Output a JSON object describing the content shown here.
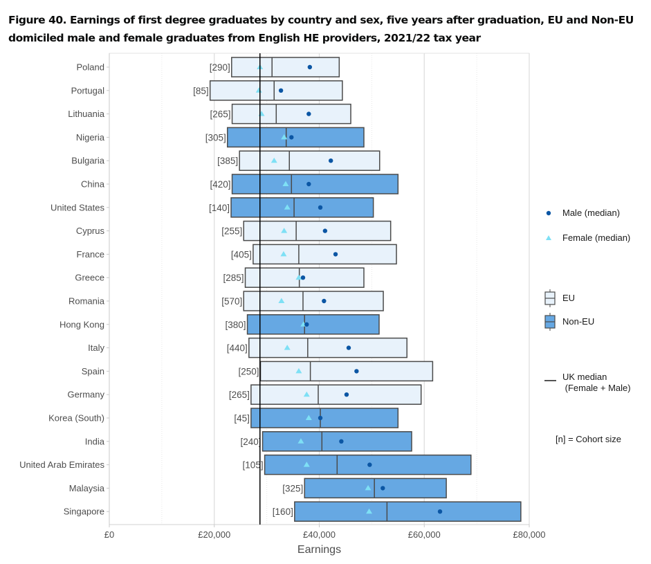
{
  "figure": {
    "title": "Figure 40. Earnings of first degree graduates by country and sex, five years after graduation, EU and Non-EU domiciled male and female graduates from English HE providers, 2021/22 tax year"
  },
  "legend": {
    "male": "Male (median)",
    "female": "Female (median)",
    "eu": "EU",
    "non_eu": "Non-EU",
    "uk_median_line1": "UK median",
    "uk_median_line2": " (Female + Male)",
    "cohort": "[n] = Cohort size"
  },
  "colors": {
    "eu_fill": "#e8f2fb",
    "non_eu_fill": "#66a8e3",
    "box_stroke": "#4a4a4a",
    "male_dot": "#0b56a4",
    "female_triangle": "#7ee0f5",
    "uk_median_line": "#000000"
  },
  "chart_data": {
    "type": "boxplot-horizontal",
    "title": "Figure 40. Earnings of first degree graduates by country and sex, five years after graduation, EU and Non-EU domiciled male and female graduates from English HE providers, 2021/22 tax year",
    "xlabel": "Earnings",
    "ylabel": "",
    "xlim": [
      0,
      80000
    ],
    "x_ticks": [
      0,
      20000,
      40000,
      60000,
      80000
    ],
    "x_tick_labels": [
      "£0",
      "£20,000",
      "£40,000",
      "£60,000",
      "£80,000"
    ],
    "grid": "major and minor vertical",
    "legend_position": "right",
    "uk_median": 28700,
    "categories": [
      "Poland",
      "Portugal",
      "Lithuania",
      "Nigeria",
      "Bulgaria",
      "China",
      "United States",
      "Cyprus",
      "France",
      "Greece",
      "Romania",
      "Hong Kong",
      "Italy",
      "Spain",
      "Germany",
      "Korea (South)",
      "India",
      "United Arab Emirates",
      "Malaysia",
      "Singapore"
    ],
    "rows": [
      {
        "country": "Poland",
        "group": "EU",
        "n": "[290]",
        "lower_quartile": 23300,
        "median": 31000,
        "upper_quartile": 43800,
        "female_median": 28700,
        "male_median": 38200
      },
      {
        "country": "Portugal",
        "group": "EU",
        "n": "[85]",
        "lower_quartile": 19200,
        "median": 31400,
        "upper_quartile": 44400,
        "female_median": 28500,
        "male_median": 32700
      },
      {
        "country": "Lithuania",
        "group": "EU",
        "n": "[265]",
        "lower_quartile": 23400,
        "median": 31800,
        "upper_quartile": 46000,
        "female_median": 29000,
        "male_median": 38000
      },
      {
        "country": "Nigeria",
        "group": "Non-EU",
        "n": "[305]",
        "lower_quartile": 22500,
        "median": 33700,
        "upper_quartile": 48500,
        "female_median": 33300,
        "male_median": 34700
      },
      {
        "country": "Bulgaria",
        "group": "EU",
        "n": "[385]",
        "lower_quartile": 24800,
        "median": 34300,
        "upper_quartile": 51500,
        "female_median": 31400,
        "male_median": 42200
      },
      {
        "country": "China",
        "group": "Non-EU",
        "n": "[420]",
        "lower_quartile": 23400,
        "median": 34700,
        "upper_quartile": 55000,
        "female_median": 33600,
        "male_median": 38000
      },
      {
        "country": "United States",
        "group": "Non-EU",
        "n": "[140]",
        "lower_quartile": 23200,
        "median": 35200,
        "upper_quartile": 50300,
        "female_median": 33900,
        "male_median": 40200
      },
      {
        "country": "Cyprus",
        "group": "EU",
        "n": "[255]",
        "lower_quartile": 25600,
        "median": 35600,
        "upper_quartile": 53600,
        "female_median": 33300,
        "male_median": 41100
      },
      {
        "country": "France",
        "group": "EU",
        "n": "[405]",
        "lower_quartile": 27400,
        "median": 36100,
        "upper_quartile": 54700,
        "female_median": 33200,
        "male_median": 43100
      },
      {
        "country": "Greece",
        "group": "EU",
        "n": "[285]",
        "lower_quartile": 25900,
        "median": 36200,
        "upper_quartile": 48500,
        "female_median": 36100,
        "male_median": 36900
      },
      {
        "country": "Romania",
        "group": "EU",
        "n": "[570]",
        "lower_quartile": 25600,
        "median": 36900,
        "upper_quartile": 52200,
        "female_median": 32800,
        "male_median": 40900
      },
      {
        "country": "Hong Kong",
        "group": "Non-EU",
        "n": "[380]",
        "lower_quartile": 26300,
        "median": 37200,
        "upper_quartile": 51400,
        "female_median": 37000,
        "male_median": 37600
      },
      {
        "country": "Italy",
        "group": "EU",
        "n": "[440]",
        "lower_quartile": 26600,
        "median": 37800,
        "upper_quartile": 56700,
        "female_median": 33900,
        "male_median": 45600
      },
      {
        "country": "Spain",
        "group": "EU",
        "n": "[250]",
        "lower_quartile": 28800,
        "median": 38300,
        "upper_quartile": 61600,
        "female_median": 36100,
        "male_median": 47100
      },
      {
        "country": "Germany",
        "group": "EU",
        "n": "[265]",
        "lower_quartile": 27000,
        "median": 39800,
        "upper_quartile": 59400,
        "female_median": 37600,
        "male_median": 45200
      },
      {
        "country": "Korea (South)",
        "group": "Non-EU",
        "n": "[45]",
        "lower_quartile": 27000,
        "median": 40200,
        "upper_quartile": 55000,
        "female_median": 38000,
        "male_median": 40200
      },
      {
        "country": "India",
        "group": "Non-EU",
        "n": "[240]",
        "lower_quartile": 29200,
        "median": 40500,
        "upper_quartile": 57600,
        "female_median": 36500,
        "male_median": 44200
      },
      {
        "country": "United Arab Emirates",
        "group": "Non-EU",
        "n": "[105]",
        "lower_quartile": 29600,
        "median": 43400,
        "upper_quartile": 68900,
        "female_median": 37600,
        "male_median": 49600
      },
      {
        "country": "Malaysia",
        "group": "Non-EU",
        "n": "[325]",
        "lower_quartile": 37200,
        "median": 50500,
        "upper_quartile": 64200,
        "female_median": 49300,
        "male_median": 52100
      },
      {
        "country": "Singapore",
        "group": "Non-EU",
        "n": "[160]",
        "lower_quartile": 35300,
        "median": 52900,
        "upper_quartile": 78400,
        "female_median": 49500,
        "male_median": 63000
      }
    ]
  }
}
